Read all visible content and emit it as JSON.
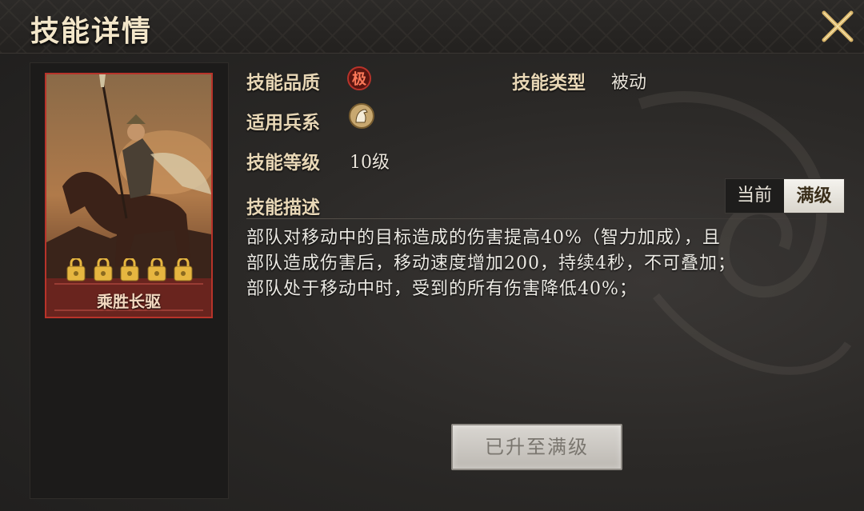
{
  "header": {
    "title": "技能详情"
  },
  "skill": {
    "card_name": "乘胜长驱",
    "quality_label": "技能品质",
    "quality_value": "极",
    "type_label": "技能类型",
    "type_value": "被动",
    "troop_label": "适用兵系",
    "troop_icon": "horse-icon",
    "level_label": "技能等级",
    "level_value": "10级",
    "desc_label": "技能描述",
    "description": [
      "部队对移动中的目标造成的伤害提高40%（智力加成），且",
      "部队造成伤害后，移动速度增加200，持续4秒，不可叠加；",
      "部队处于移动中时，受到的所有伤害降低40%；"
    ],
    "star_count": 5
  },
  "toggle": {
    "current_label": "当前",
    "max_label": "满级",
    "selected": "max"
  },
  "action": {
    "maxed_label": "已升至满级"
  },
  "colors": {
    "quality_red": "#b8332a",
    "gold": "#e6b640"
  }
}
